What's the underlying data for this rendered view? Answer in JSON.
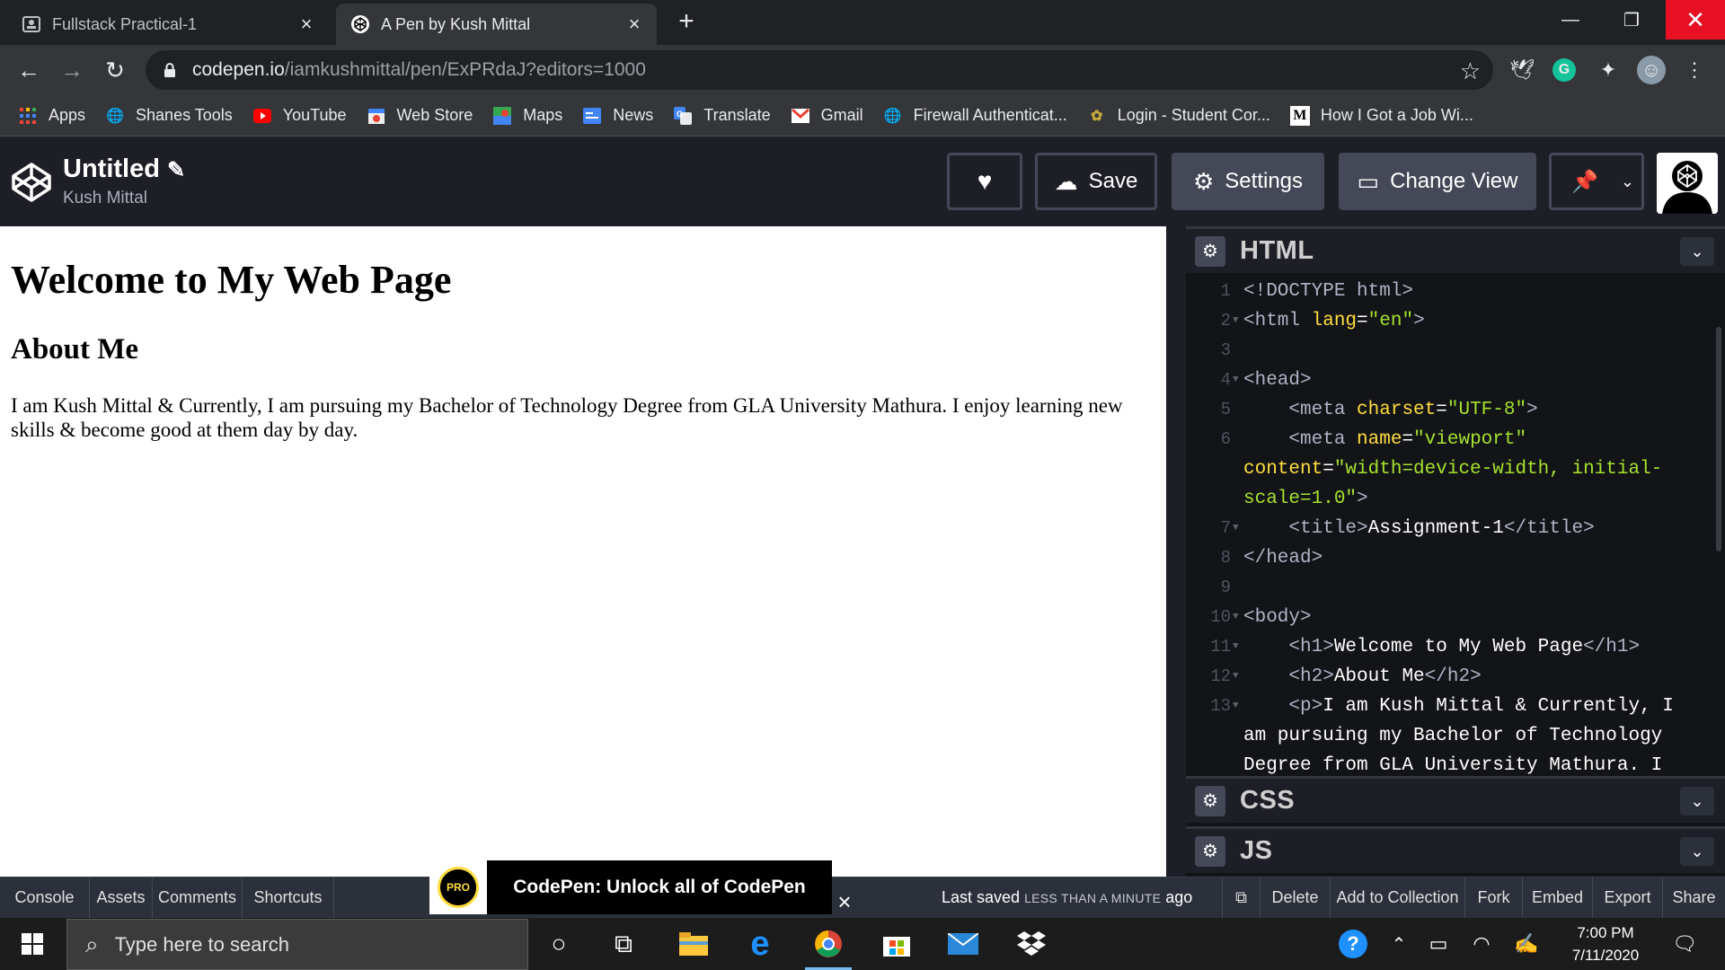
{
  "browser": {
    "tabs": [
      {
        "title": "Fullstack Practical-1",
        "active": false
      },
      {
        "title": "A Pen by Kush Mittal",
        "active": true
      }
    ],
    "url_host": "codepen.io",
    "url_path": "/iamkushmittal/pen/ExPRdaJ?editors=1000",
    "bookmarks": [
      {
        "label": "Apps",
        "icon": "apps-grid-icon"
      },
      {
        "label": "Shanes Tools",
        "icon": "globe-icon"
      },
      {
        "label": "YouTube",
        "icon": "youtube-icon"
      },
      {
        "label": "Web Store",
        "icon": "web-store-icon"
      },
      {
        "label": "Maps",
        "icon": "maps-icon"
      },
      {
        "label": "News",
        "icon": "news-icon"
      },
      {
        "label": "Translate",
        "icon": "translate-icon"
      },
      {
        "label": "Gmail",
        "icon": "gmail-icon"
      },
      {
        "label": "Firewall Authenticat...",
        "icon": "globe-icon"
      },
      {
        "label": "Login - Student Cor...",
        "icon": "student-portal-icon"
      },
      {
        "label": "How I Got a Job Wi...",
        "icon": "medium-icon"
      }
    ]
  },
  "codepen": {
    "title": "Untitled",
    "author": "Kush Mittal",
    "buttons": {
      "save": "Save",
      "settings": "Settings",
      "change_view": "Change View"
    }
  },
  "result": {
    "h1": "Welcome to My Web Page",
    "h2": "About Me",
    "p": "I am Kush Mittal & Currently, I am pursuing my Bachelor of Technology Degree from GLA University Mathura. I enjoy learning new skills & become good at them day by day."
  },
  "editors": {
    "html_label": "HTML",
    "css_label": "CSS",
    "js_label": "JS",
    "line_numbers": [
      "1",
      "2",
      "3",
      "4",
      "5",
      "6",
      "7",
      "8",
      "9",
      "10",
      "11",
      "12",
      "13"
    ],
    "code": {
      "l1_tag": "<!DOCTYPE html>",
      "l2_open": "<html ",
      "l2_attr": "lang",
      "l2_eq": "=",
      "l2_val": "\"en\"",
      "l2_close": ">",
      "l4": "<head>",
      "l5_open": "    <meta ",
      "l5_attr": "charset",
      "l5_eq": "=",
      "l5_val": "\"UTF-8\"",
      "l5_close": ">",
      "l6_open": "    <meta ",
      "l6_attr": "name",
      "l6_eq": "=",
      "l6_val": "\"viewport\"",
      "l6b_attr": "content",
      "l6b_eq": "=",
      "l6b_val": "\"width=device-width, initial-",
      "l6c_val": "scale=1.0\"",
      "l6c_close": ">",
      "l7_open": "    <title>",
      "l7_text": "Assignment-1",
      "l7_close": "</title>",
      "l8": "</head>",
      "l10": "<body>",
      "l11_open": "    <h1>",
      "l11_text": "Welcome to My Web Page",
      "l11_close": "</h1>",
      "l12_open": "    <h2>",
      "l12_text": "About Me",
      "l12_close": "</h2>",
      "l13_open": "    <p>",
      "l13_text": "I am Kush Mittal & Currently, I",
      "l13b_text": "am pursuing my Bachelor of Technology",
      "l13c_text": "Degree from GLA University Mathura. I"
    }
  },
  "footer": {
    "console": "Console",
    "assets": "Assets",
    "comments": "Comments",
    "shortcuts": "Shortcuts",
    "promo_badge": "PRO",
    "promo_text": "CodePen: Unlock all of CodePen",
    "last_saved_prefix": "Last saved ",
    "last_saved_time": "LESS THAN A MINUTE",
    "last_saved_suffix": " ago",
    "delete": "Delete",
    "add_to_collection": "Add to Collection",
    "fork": "Fork",
    "embed": "Embed",
    "export": "Export",
    "share": "Share"
  },
  "taskbar": {
    "search_placeholder": "Type here to search",
    "time": "7:00 PM",
    "date": "7/11/2020"
  },
  "colors": {
    "codepen_bg": "#1e1f26",
    "editor_bg": "#131417",
    "attr_yellow": "#ffdd40",
    "string_green": "#a6e22e",
    "promo_yellow": "#ffdd40",
    "windows_close_red": "#e81123"
  }
}
